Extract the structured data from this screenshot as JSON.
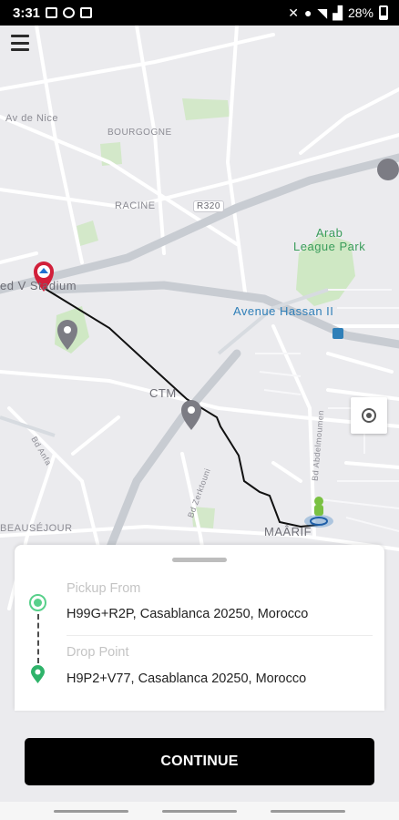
{
  "status_bar": {
    "time": "3:31",
    "battery": "28%"
  },
  "map": {
    "labels": {
      "av_de_nice": "Av de Nice",
      "bourgogne": "BOURGOGNE",
      "racine": "RACINE",
      "r320": "R320",
      "arab_league_park": "Arab\nLeague Park",
      "stadium": "ed V Stadium",
      "avenue_hassan": "Avenue Hassan II",
      "ctm": "CTM",
      "bd_anfa": "Bd Anfa",
      "bd_zerktouni": "Bd Zerktouni",
      "bd_abdelmoumen": "Bd Abdelmoumen",
      "beausejour": "BEAUSÉJOUR",
      "maarif": "MAÂRIF"
    },
    "route_color": "#111111",
    "pickup_marker_color": "#d11f3a",
    "driver_color": "#7ac142"
  },
  "trip": {
    "pickup_label": "Pickup From",
    "pickup_address": "H99G+R2P, Casablanca 20250, Morocco",
    "drop_label": "Drop Point",
    "drop_address": "H9P2+V77, Casablanca 20250, Morocco"
  },
  "actions": {
    "continue_label": "CONTINUE"
  },
  "colors": {
    "accent_green": "#58d08a",
    "button_bg": "#000000"
  }
}
